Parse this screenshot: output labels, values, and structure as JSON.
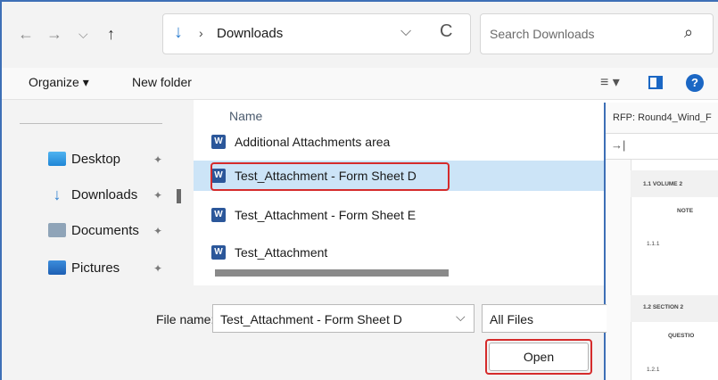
{
  "nav": {
    "back_glyph": "←",
    "forward_glyph": "→",
    "recent_glyph": "⌵",
    "up_glyph": "↑"
  },
  "address": {
    "folder_icon": "download-arrow-icon",
    "separator": "›",
    "path": "Downloads",
    "dropdown_glyph": "⌵",
    "refresh_glyph": "C"
  },
  "search": {
    "placeholder": "Search Downloads",
    "icon": "search-icon"
  },
  "toolbar": {
    "organize": "Organize ▾",
    "new_folder": "New folder",
    "view_glyph": "≡ ▾",
    "help": "?"
  },
  "sidebar": {
    "items": [
      {
        "label": "Desktop",
        "icon": "desktop-icon"
      },
      {
        "label": "Downloads",
        "icon": "download-arrow-icon"
      },
      {
        "label": "Documents",
        "icon": "documents-icon"
      },
      {
        "label": "Pictures",
        "icon": "pictures-icon"
      }
    ],
    "pin_glyph": "📌"
  },
  "filelist": {
    "column_header": "Name",
    "files": [
      {
        "name": "Additional Attachments area",
        "selected": false
      },
      {
        "name": "Test_Attachment - Form Sheet D",
        "selected": true
      },
      {
        "name": "Test_Attachment - Form Sheet E",
        "selected": false
      },
      {
        "name": "Test_Attachment",
        "selected": false
      }
    ],
    "word_icon_letter": "W"
  },
  "preview": {
    "title": "RFP: Round4_Wind_F",
    "toolbar_glyph": "→|",
    "lines": [
      "1.1 VOLUME 2",
      "NOTE",
      "1.1.1",
      "1.2 SECTION 2",
      "QUESTIO",
      "1.2.1"
    ]
  },
  "footer": {
    "file_name_label": "File name:",
    "file_name_value": "Test_Attachment - Form Sheet D",
    "file_name_dropdown": "⌵",
    "filter_value": "All Files",
    "open_label": "Open"
  },
  "colors": {
    "accent": "#1b67c4",
    "selection": "#cce4f7",
    "highlight_box": "#d52b2b",
    "window_border": "#3d6fb6"
  }
}
